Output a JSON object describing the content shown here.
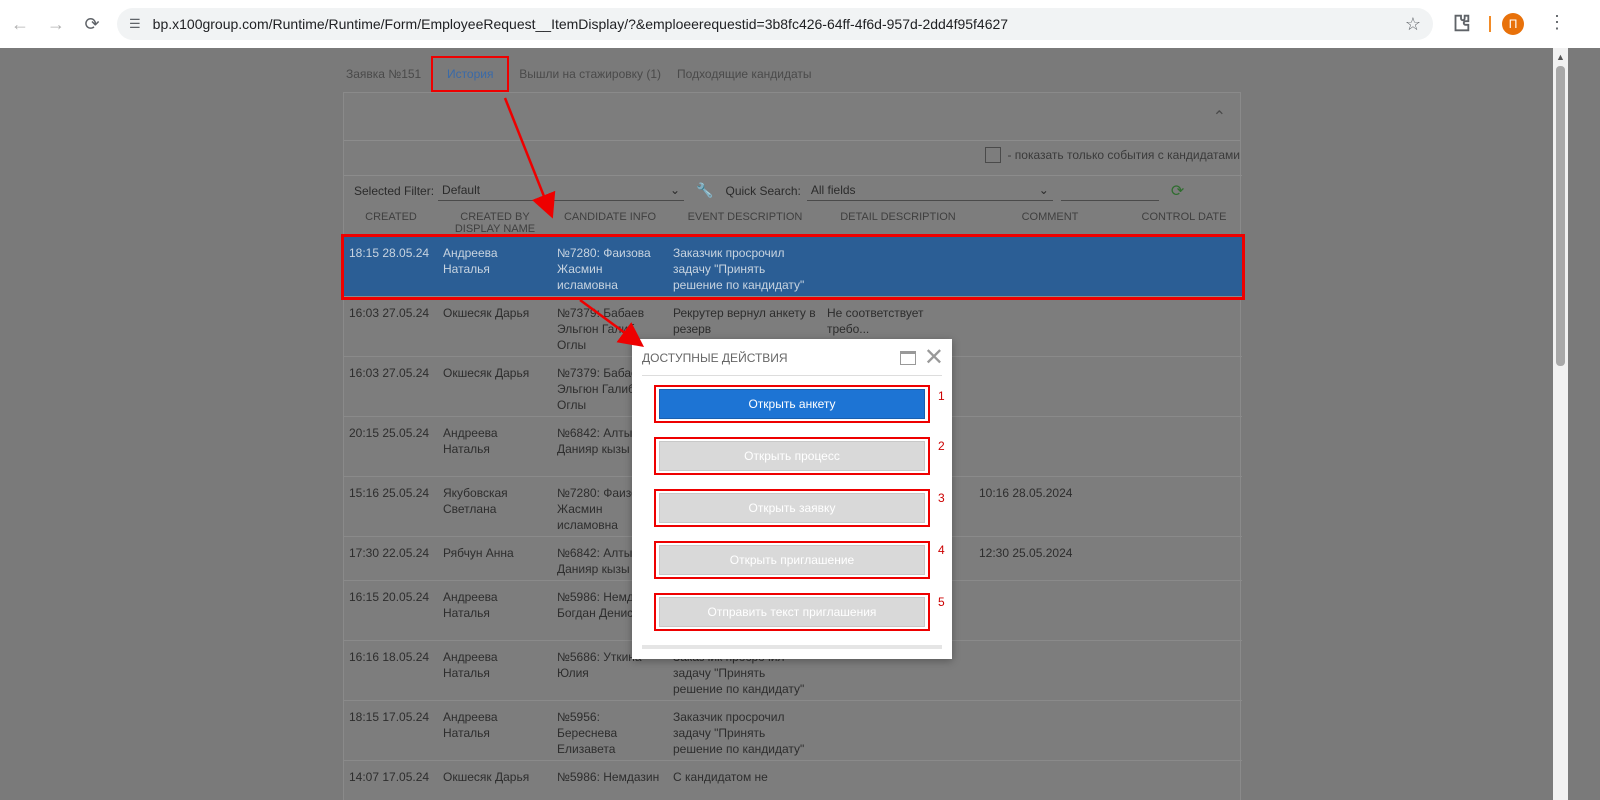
{
  "browser": {
    "url": "bp.x100group.com/Runtime/Runtime/Form/EmployeeRequest__ItemDisplay/?&emploeerequestid=3b8fc426-64ff-4f6d-957d-2dd4f95f4627",
    "avatar_letter": "П"
  },
  "tabs": [
    {
      "label": "Заявка №151"
    },
    {
      "label": "История"
    },
    {
      "label": "Вышли на стажировку (1)"
    },
    {
      "label": "Подходящие кандидаты"
    }
  ],
  "filter": {
    "checkbox_label": "- показать только события с кандидатами",
    "selected_filter_label": "Selected Filter:",
    "selected_filter_value": "Default",
    "quick_search_label": "Quick Search:",
    "quick_search_value": "All fields"
  },
  "table": {
    "columns": [
      "CREATED",
      "CREATED BY DISPLAY NAME",
      "CANDIDATE INFO",
      "EVENT DESCRIPTION",
      "DETAIL DESCRIPTION",
      "COMMENT",
      "CONTROL DATE"
    ],
    "rows": [
      {
        "created": "18:15 28.05.24",
        "by": "Андреева Наталья",
        "candidate": "№7280: Фаизова Жасмин исламовна",
        "event": "Заказчик просрочил задачу \"Принять решение по кандидату\"",
        "detail": "",
        "comment": "",
        "control": ""
      },
      {
        "created": "16:03 27.05.24",
        "by": "Окшесяк Дарья",
        "candidate": "№7379: Бабаев Эльгюн Галиб Оглы",
        "event": "Рекрутер вернул анкету в резерв",
        "detail": "Не соответствует требо...",
        "comment": "",
        "control": ""
      },
      {
        "created": "16:03 27.05.24",
        "by": "Окшесяк Дарья",
        "candidate": "№7379: Бабаев Эльгюн Галиб Оглы",
        "event": "",
        "detail": "",
        "comment": "",
        "control": ""
      },
      {
        "created": "20:15 25.05.24",
        "by": "Андреева Наталья",
        "candidate": "№6842: Алтынбек Данияр кызы",
        "event": "",
        "detail": "",
        "comment": "",
        "control": ""
      },
      {
        "created": "15:16 25.05.24",
        "by": "Якубовская Светлана",
        "candidate": "№7280: Фаизова Жасмин исламовна",
        "event": "",
        "detail": "",
        "comment": "10:16 28.05.2024",
        "control": ""
      },
      {
        "created": "17:30 22.05.24",
        "by": "Рябчун Анна",
        "candidate": "№6842: Алтынбек Данияр кызы",
        "event": "",
        "detail": "",
        "comment": "12:30 25.05.2024",
        "control": ""
      },
      {
        "created": "16:15 20.05.24",
        "by": "Андреева Наталья",
        "candidate": "№5986: Немдазин Богдан Денисович",
        "event": "",
        "detail": "",
        "comment": "",
        "control": ""
      },
      {
        "created": "16:16 18.05.24",
        "by": "Андреева Наталья",
        "candidate": "№5686: Уткина Юлия",
        "event": "Заказчик просрочил задачу \"Принять решение по кандидату\"",
        "detail": "",
        "comment": "",
        "control": ""
      },
      {
        "created": "18:15 17.05.24",
        "by": "Андреева Наталья",
        "candidate": "№5956: Береснева Елизавета Ивановна",
        "event": "Заказчик просрочил задачу \"Принять решение по кандидату\"",
        "detail": "",
        "comment": "",
        "control": ""
      },
      {
        "created": "14:07 17.05.24",
        "by": "Окшесяк Дарья",
        "candidate": "№5986: Немдазин",
        "event": "С кандидатом не",
        "detail": "",
        "comment": "",
        "control": ""
      }
    ]
  },
  "modal": {
    "title": "ДОСТУПНЫЕ ДЕЙСТВИЯ",
    "actions": [
      {
        "label": "Открыть анкету",
        "num": "1"
      },
      {
        "label": "Открыть процесс",
        "num": "2"
      },
      {
        "label": "Открыть заявку",
        "num": "3"
      },
      {
        "label": "Открыть приглашение",
        "num": "4"
      },
      {
        "label": "Отправить текст приглашения",
        "num": "5"
      }
    ]
  }
}
